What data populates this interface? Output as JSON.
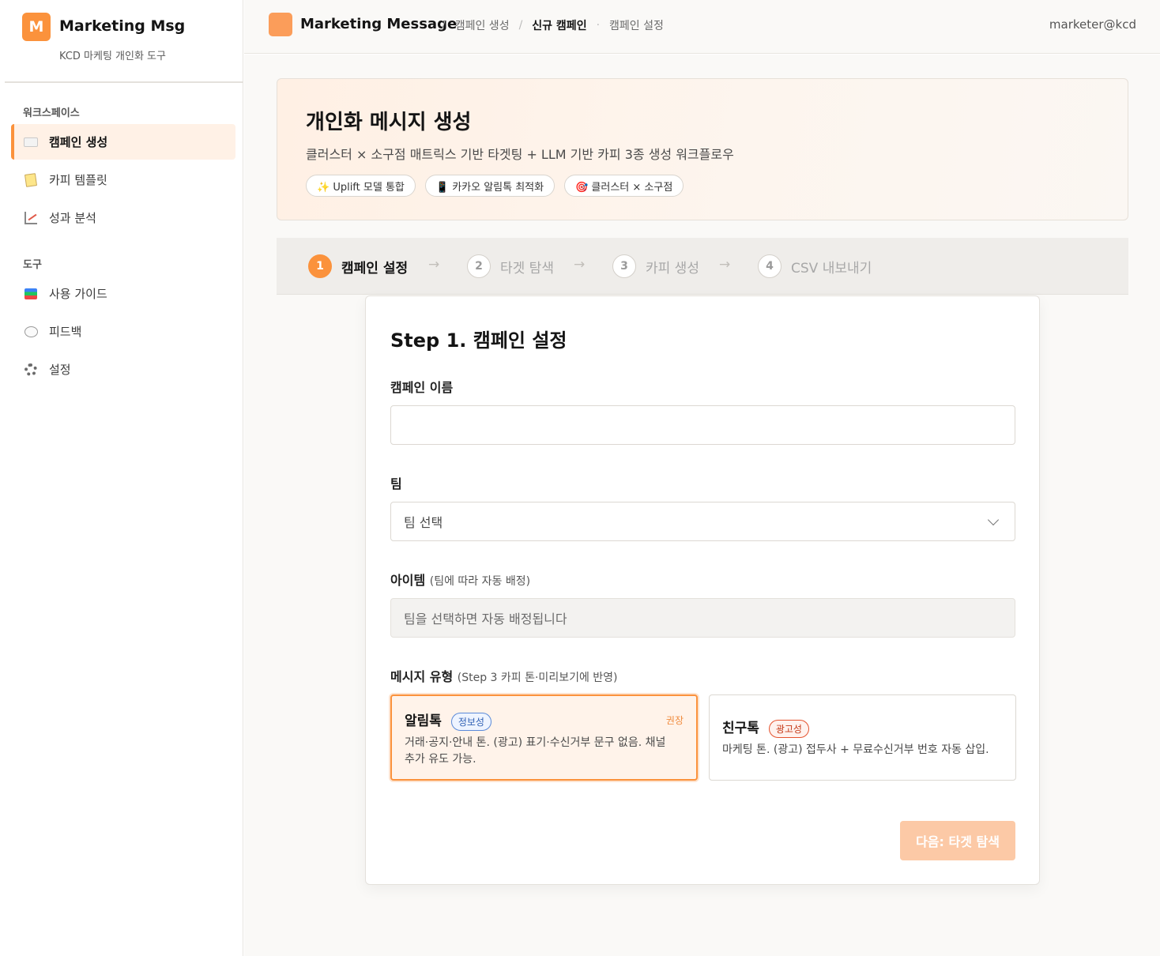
{
  "sidebar": {
    "logo_letter": "M",
    "app_name": "Marketing Msg",
    "app_sub": "KCD 마케팅 개인화 도구",
    "workspace_label": "워크스페이스",
    "tools_label": "도구",
    "workspace_items": [
      {
        "label": "캠페인 생성",
        "icon": "envelope-icon",
        "active": true
      },
      {
        "label": "카피 템플릿",
        "icon": "memo-icon"
      },
      {
        "label": "성과 분석",
        "icon": "chart-icon"
      }
    ],
    "tool_items": [
      {
        "label": "사용 가이드",
        "icon": "books-icon"
      },
      {
        "label": "피드백",
        "icon": "speech-bubble-icon"
      },
      {
        "label": "설정",
        "icon": "gear-icon"
      }
    ]
  },
  "header": {
    "title": "Marketing Message",
    "breadcrumbs": [
      "캠페인 생성",
      "신규 캠페인",
      "캠페인 설정"
    ],
    "user": "marketer@kcd"
  },
  "hero": {
    "title": "개인화 메시지 생성",
    "subtitle": "클러스터 × 소구점 매트릭스 기반 타겟팅 + LLM 기반 카피 3종 생성 워크플로우",
    "chips": [
      "✨ Uplift 모델 통합",
      "📱 카카오 알림톡 최적화",
      "🎯 클러스터 × 소구점"
    ]
  },
  "stepper": {
    "steps": [
      {
        "num": "1",
        "label": "캠페인 설정",
        "active": true
      },
      {
        "num": "2",
        "label": "타겟 탐색"
      },
      {
        "num": "3",
        "label": "카피 생성"
      },
      {
        "num": "4",
        "label": "CSV 내보내기"
      }
    ],
    "arrow": "→"
  },
  "form": {
    "title": "Step 1. 캠페인 설정",
    "campaign_name_label": "캠페인 이름",
    "campaign_name_value": "",
    "team_label": "팀",
    "team_selected": "팀 선택",
    "item_label": "아이템",
    "item_note": "(팀에 따라 자동 배정)",
    "item_value": "팀을 선택하면 자동 배정됩니다",
    "msg_type_label": "메시지 유형",
    "msg_type_note": "(Step 3 카피 톤·미리보기에 반영)",
    "types": [
      {
        "name": "알림톡",
        "badge": "정보성",
        "tag": "권장",
        "desc": "거래·공지·안내 톤. (광고) 표기·수신거부 문구 없음. 채널 추가 유도 가능.",
        "selected": true
      },
      {
        "name": "친구톡",
        "badge": "광고성",
        "desc": "마케팅 톤. (광고) 접두사 + 무료수신거부 번호 자동 삽입."
      }
    ],
    "next_label": "다음: 타겟 탐색"
  },
  "colors": {
    "accent": "#fb923c",
    "next_disabled": "#fcc9a6",
    "info_badge": "#5b8ad9",
    "ad_badge": "#e5532f"
  }
}
